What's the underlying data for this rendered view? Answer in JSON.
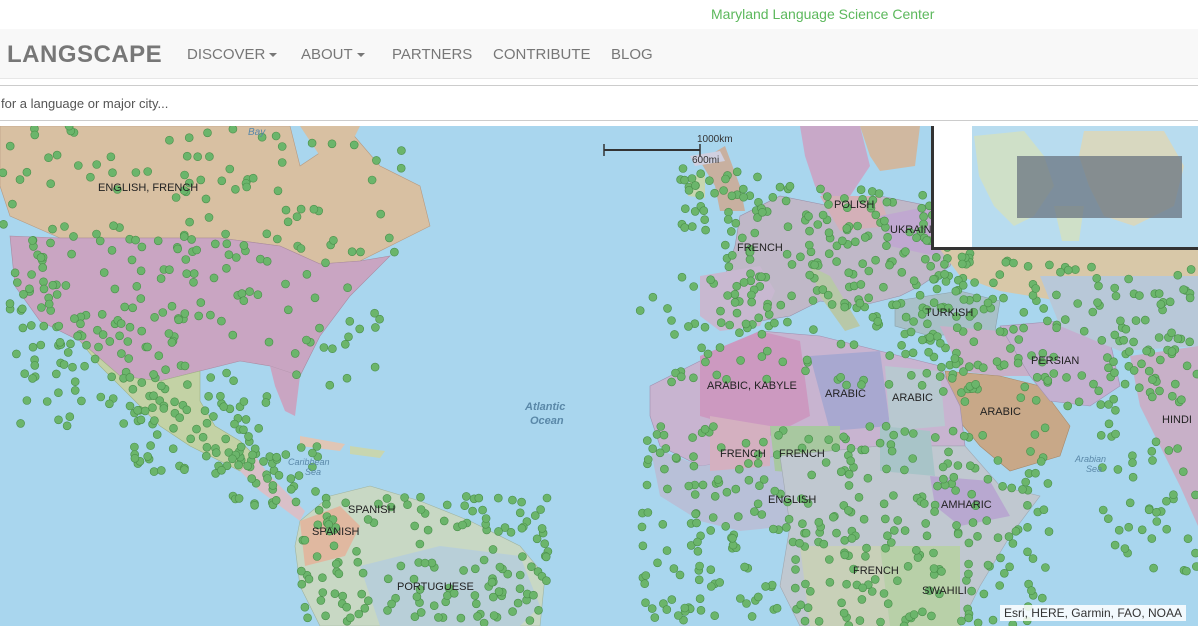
{
  "header": {
    "org_link": "Maryland Language Science Center"
  },
  "navbar": {
    "brand": "LANGSCAPE",
    "items": [
      {
        "label": "DISCOVER",
        "dropdown": true
      },
      {
        "label": "ABOUT",
        "dropdown": true
      },
      {
        "label": "PARTNERS",
        "dropdown": false
      },
      {
        "label": "CONTRIBUTE",
        "dropdown": false
      },
      {
        "label": "BLOG",
        "dropdown": false
      }
    ]
  },
  "search": {
    "placeholder": "for a language or major city..."
  },
  "map": {
    "scale_km": "1000km",
    "scale_mi": "600mi",
    "attribution": "Esri, HERE, Garmin, FAO, NOAA",
    "water_labels": [
      "Bay",
      "Atlantic",
      "Ocean",
      "Caribbean",
      "Sea",
      "Arabian",
      "Sea"
    ],
    "language_labels": [
      "ENGLISH, FRENCH",
      "POLISH",
      "UKRAIN",
      "FRENCH",
      "TURKISH",
      "PERSIAN",
      "ARABIC, KABYLE",
      "ARABIC",
      "ARABIC",
      "ARABIC",
      "HINDI",
      "FRENCH",
      "FRENCH",
      "ENGLISH",
      "AMHARIC",
      "SPANISH",
      "SPANISH",
      "PORTUGUESE",
      "FRENCH",
      "SWAHILI"
    ],
    "colors": {
      "water": "#a9d6ee",
      "point": "#6bb56b",
      "point_stroke": "#4a8f4a"
    }
  }
}
